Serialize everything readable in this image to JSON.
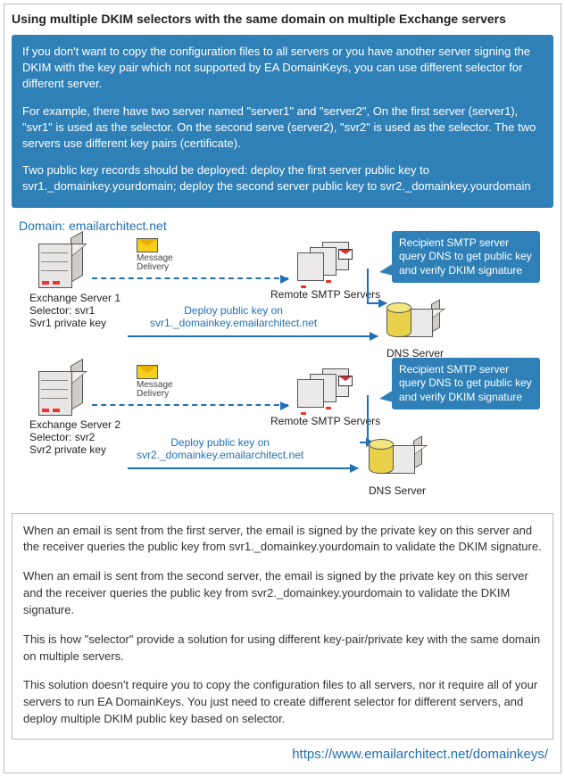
{
  "title": "Using multiple DKIM selectors with the same domain on multiple Exchange servers",
  "intro": {
    "p1": "If you don't want to copy the configuration files to all servers or you have another server signing the DKIM with the key pair which not supported by EA DomainKeys, you can use different selector for different server.",
    "p2": "For example, there have two server named \"server1\" and \"server2\", On the first server (server1), \"svr1\" is used as the selector. On the second serve (server2), \"svr2\" is used as the selector. The two servers use different key pairs (certificate).",
    "p3": "Two public key records should be deployed: deploy the first server public key to svr1._domainkey.yourdomain; deploy the second server public key to svr2._domainkey.yourdomain"
  },
  "diagram": {
    "domain": "Domain: emailarchitect.net",
    "msg_delivery": "Message\nDelivery",
    "exchange1": {
      "name": "Exchange Server 1",
      "selector": "Selector: svr1",
      "key": "Svr1 private key"
    },
    "exchange2": {
      "name": "Exchange Server 2",
      "selector": "Selector: svr2",
      "key": "Svr2 private key"
    },
    "remote_smtp": "Remote SMTP Servers",
    "dns_server": "DNS Server",
    "deploy1": "Deploy public key on\nsvr1._domainkey.emailarchitect.net",
    "deploy2": "Deploy public key on\nsvr2._domainkey.emailarchitect.net",
    "callout": "Recipient SMTP server query DNS to get public key and verify DKIM signature"
  },
  "body": {
    "p1": "When an email is sent from the first server, the email is signed by the private key on this server and the receiver queries the public key from svr1._domainkey.yourdomain to validate the DKIM signature.",
    "p2": "When an email is sent from the second server, the email is signed by the private key on this server and the receiver queries the public key from svr2._domainkey.yourdomain to validate the DKIM signature.",
    "p3": "This is how \"selector\" provide a solution for using different key-pair/private key with the same domain on multiple servers.",
    "p4": "This solution doesn't require you to copy the configuration files to all servers, nor it require all of your servers to run EA DomainKeys. You just need to create different selector for different servers, and deploy multiple DKIM public key based on selector."
  },
  "footer_url": "https://www.emailarchitect.net/domainkeys/"
}
